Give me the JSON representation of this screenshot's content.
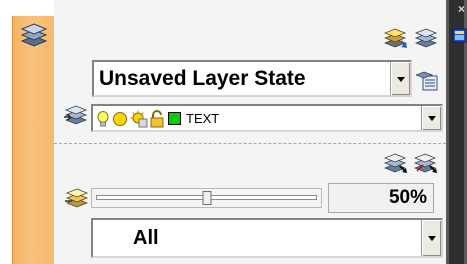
{
  "panel": {
    "close_glyph": "×",
    "icons": {
      "sidebar": "layer-stack-icon",
      "top_right_1": "layer-state-manager-icon",
      "top_right_2": "layer-properties-icon",
      "restore_state": "restore-layer-state-icon",
      "current_layer": "current-layer-icon",
      "isolate": "isolate-layer-icon",
      "unisolate": "unisolate-layer-icon",
      "fade": "layer-fade-icon",
      "properties": "properties-palette-icon"
    },
    "colors": {
      "strip": "#f6b86c",
      "layer_swatch": "#00d000"
    }
  },
  "layer_state": {
    "selected": "Unsaved Layer State"
  },
  "current_layer": {
    "name": "TEXT"
  },
  "fade": {
    "value_percent": 50,
    "label": "50%"
  },
  "filter": {
    "selected": "All"
  }
}
